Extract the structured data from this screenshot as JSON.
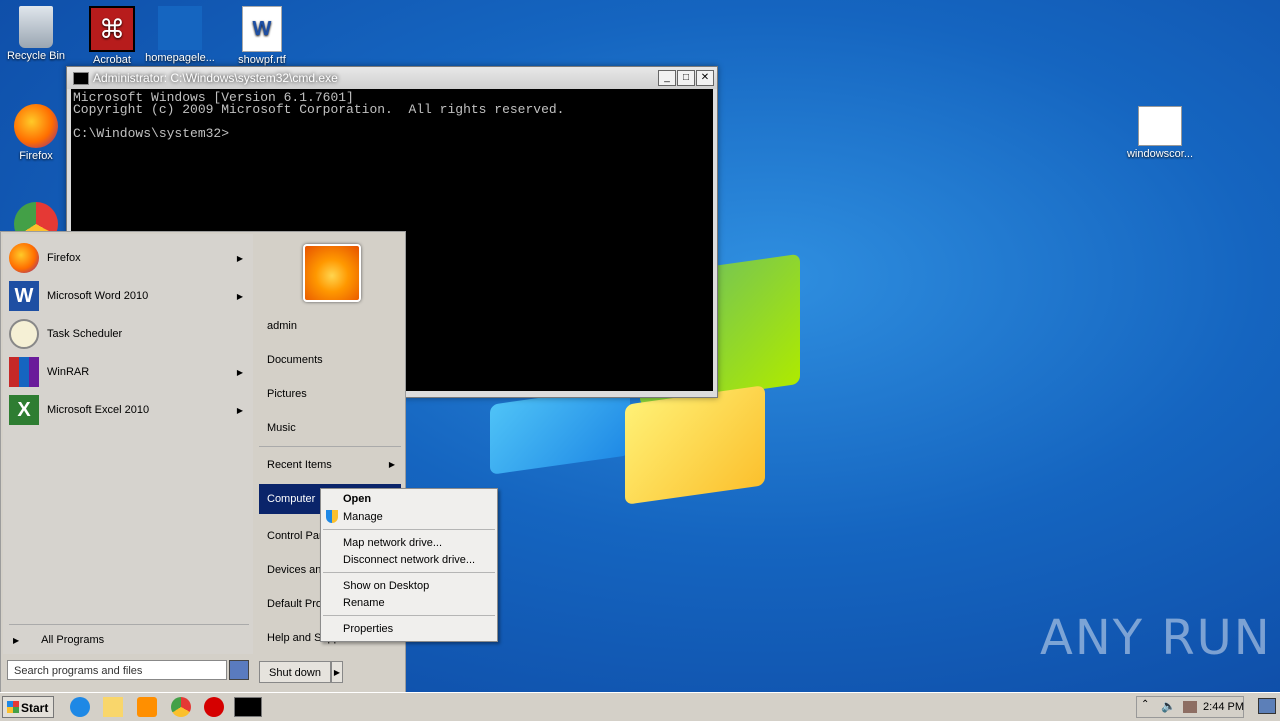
{
  "desktop": {
    "icons": [
      {
        "label": "Recycle Bin"
      },
      {
        "label": "Acrobat"
      },
      {
        "label": "homepagele..."
      },
      {
        "label": "showpf.rtf"
      },
      {
        "label": "Firefox"
      },
      {
        "label": "windowscor..."
      }
    ],
    "watermark": "ANY RUN"
  },
  "cmd": {
    "title": "Administrator: C:\\Windows\\system32\\cmd.exe",
    "lines": [
      "Microsoft Windows [Version 6.1.7601]",
      "Copyright (c) 2009 Microsoft Corporation.  All rights reserved.",
      "",
      "C:\\Windows\\system32>"
    ],
    "btn_min": "_",
    "btn_max": "□",
    "btn_close": "✕"
  },
  "start_menu": {
    "programs": [
      {
        "label": "Firefox",
        "has_arrow": true
      },
      {
        "label": "Microsoft Word 2010",
        "has_arrow": true
      },
      {
        "label": "Task Scheduler",
        "has_arrow": false
      },
      {
        "label": "WinRAR",
        "has_arrow": true
      },
      {
        "label": "Microsoft Excel 2010",
        "has_arrow": true
      }
    ],
    "all_programs": "All Programs",
    "search_placeholder": "Search programs and files",
    "right_items": [
      "admin",
      "Documents",
      "Pictures",
      "Music",
      "Recent Items",
      "Computer",
      "Control Panel",
      "Devices and Printers",
      "Default Programs",
      "Help and Support"
    ],
    "shutdown": "Shut down"
  },
  "context_menu": {
    "items": [
      "Open",
      "Manage",
      "Map network drive...",
      "Disconnect network drive...",
      "Show on Desktop",
      "Rename",
      "Properties"
    ]
  },
  "taskbar": {
    "start": "Start",
    "clock": "2:44 PM"
  },
  "colors": {
    "selection": "#0a246a",
    "desktop": "#1565c0"
  }
}
